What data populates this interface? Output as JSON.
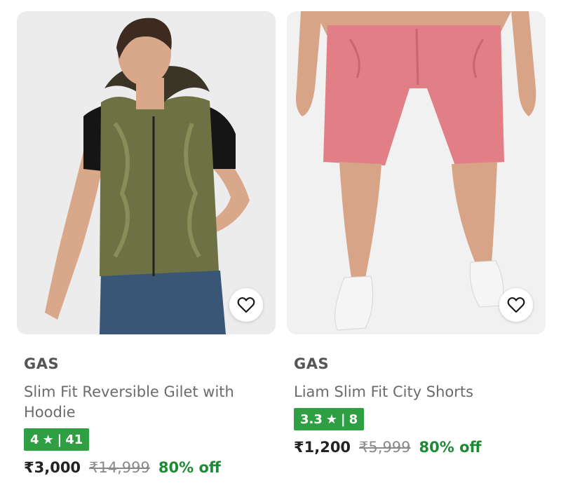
{
  "products": [
    {
      "brand": "GAS",
      "title": "Slim Fit Reversible Gilet with Hoodie",
      "rating": "4",
      "rating_count": "41",
      "price": "₹3,000",
      "mrp": "₹14,999",
      "discount": "80% off",
      "image_desc": "olive-green-hooded-gilet-model",
      "wishlist_icon": "heart-outline-icon"
    },
    {
      "brand": "GAS",
      "title": "Liam Slim Fit City Shorts",
      "rating": "3.3",
      "rating_count": "8",
      "price": "₹1,200",
      "mrp": "₹5,999",
      "discount": "80% off",
      "image_desc": "pink-shorts-model",
      "wishlist_icon": "heart-outline-icon"
    }
  ],
  "colors": {
    "rating_bg": "#2ea043",
    "discount": "#1f8a36",
    "image_bg": "#efefef"
  },
  "rating_separator": "|"
}
